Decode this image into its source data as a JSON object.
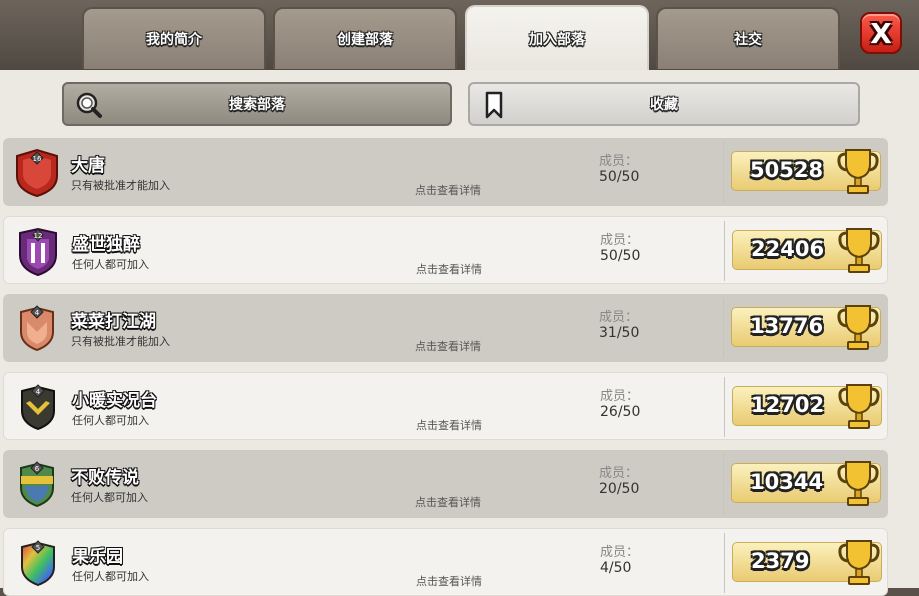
{
  "tabs": [
    {
      "label": "我的简介"
    },
    {
      "label": "创建部落"
    },
    {
      "label": "加入部落"
    },
    {
      "label": "社交"
    }
  ],
  "close_label": "X",
  "buttons": {
    "search_label": "搜索部落",
    "favorites_label": "收藏"
  },
  "row_common": {
    "members_label": "成员：",
    "details_label": "点击查看详情"
  },
  "clans": [
    {
      "name": "大唐",
      "level": "16",
      "join_type": "只有被批准才能加入",
      "members": "50/50",
      "trophies": "50528"
    },
    {
      "name": "盛世独醉",
      "level": "12",
      "join_type": "任何人都可加入",
      "members": "50/50",
      "trophies": "22406"
    },
    {
      "name": "菜菜打江湖",
      "level": "4",
      "join_type": "只有被批准才能加入",
      "members": "31/50",
      "trophies": "13776"
    },
    {
      "name": "小暖实况台",
      "level": "4",
      "join_type": "任何人都可加入",
      "members": "26/50",
      "trophies": "12702"
    },
    {
      "name": "不败传说",
      "level": "6",
      "join_type": "任何人都可加入",
      "members": "20/50",
      "trophies": "10344"
    },
    {
      "name": "果乐园",
      "level": "5",
      "join_type": "任何人都可加入",
      "members": "4/50",
      "trophies": "2379"
    }
  ],
  "colors": {
    "accent_gold": "#e9cb71",
    "close_red": "#c81e14"
  }
}
